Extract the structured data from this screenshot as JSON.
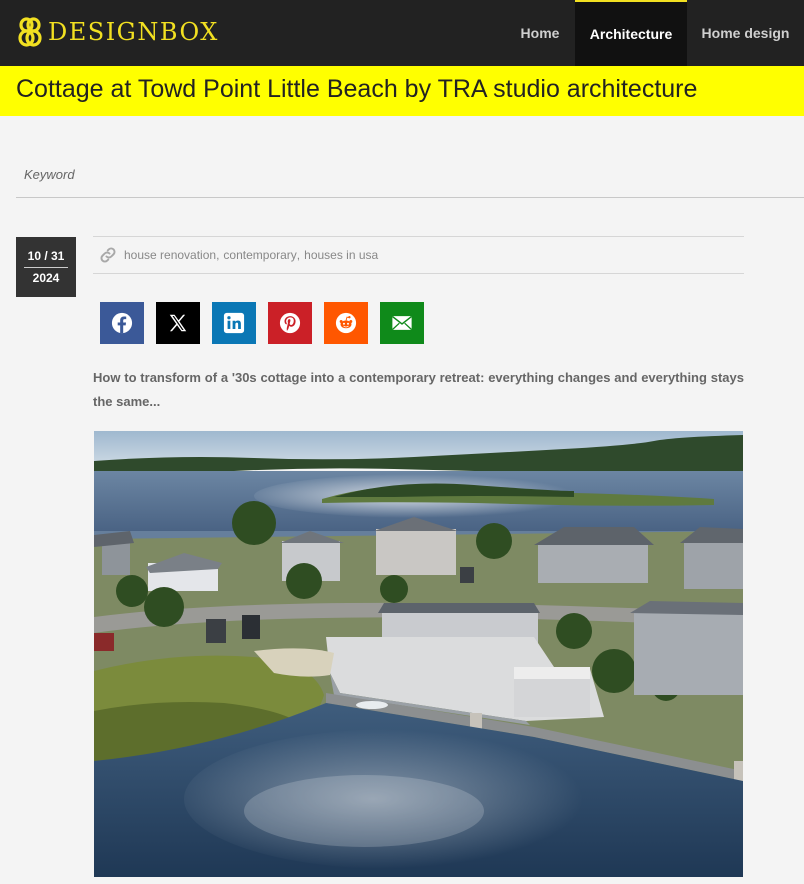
{
  "header": {
    "logo_text": "DESIGNBOX",
    "nav": [
      "Home",
      "Architecture",
      "Home design"
    ],
    "active_nav": "Architecture"
  },
  "article": {
    "title": "Cottage at Towd Point Little Beach by TRA studio architecture",
    "date": {
      "month_day": "10 / 31",
      "year": "2024"
    },
    "tags": [
      "house renovation",
      "contemporary",
      "houses in usa"
    ],
    "excerpt": "How to transform of a '30s cottage into a contemporary retreat: everything changes and everything stays the same...",
    "image_alt": "aerial view of cottage on waterfront"
  },
  "search": {
    "placeholder": "Keyword",
    "value": ""
  },
  "share": [
    {
      "name": "facebook",
      "icon": "facebook-icon",
      "color": "#3b5998"
    },
    {
      "name": "x",
      "icon": "x-icon",
      "color": "#000000"
    },
    {
      "name": "linkedin",
      "icon": "linkedin-icon",
      "color": "#0a77b5"
    },
    {
      "name": "pinterest",
      "icon": "pinterest-icon",
      "color": "#cb2027"
    },
    {
      "name": "reddit",
      "icon": "reddit-icon",
      "color": "#ff5700"
    },
    {
      "name": "email",
      "icon": "email-icon",
      "color": "#0f8a1a"
    }
  ],
  "colors": {
    "header_bg": "#222222",
    "logo": "#f2e021",
    "title_band": "#ffff00",
    "page_bg": "#f4f4f4"
  }
}
